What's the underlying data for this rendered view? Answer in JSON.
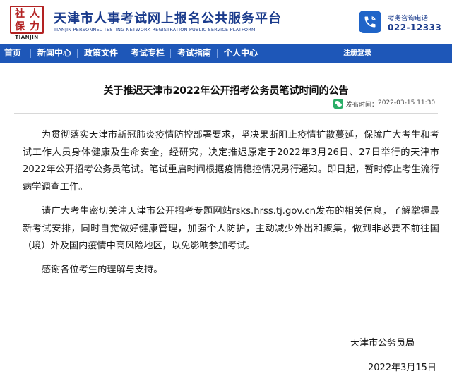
{
  "header": {
    "logo_text": "社人力保",
    "logo_chars": [
      "社",
      "人",
      "保",
      "力"
    ],
    "logo_english": "TIANJIN",
    "site_title": "天津市人事考试网上报名公共服务平台",
    "site_subtitle": "TIANJIN PERSONNEL TESTING NETWORK REGISTRATION PUBLIC SERVICE PLATFORM",
    "hotline_label": "考务咨询电话",
    "hotline_number": "022-12333",
    "phone_icon": "phone-icon",
    "brand_color": "#1a3b8c",
    "seal_color": "#b32222"
  },
  "nav": {
    "items": [
      {
        "label": "首页"
      },
      {
        "label": "新闻中心"
      },
      {
        "label": "政策文件"
      },
      {
        "label": "考试专栏"
      },
      {
        "label": "考试指南"
      },
      {
        "label": "个人中心"
      }
    ],
    "login_label": "注册登录",
    "bar_color": "#1e57b8"
  },
  "article": {
    "title": "关于推迟天津市2022年公开招考公务员笔试时间的公告",
    "publish_icon": "wechat-icon",
    "publish_label": "发布时间：",
    "publish_time": "2022-03-15 11:30",
    "paragraphs": [
      "为贯彻落实天津市新冠肺炎疫情防控部署要求，坚决果断阻止疫情扩散蔓延，保障广大考生和考试工作人员身体健康及生命安全，经研究，决定推迟原定于2022年3月26日、27日举行的天津市2022年公开招考公务员笔试。笔试重启时间根据疫情稳控情况另行通知。即日起，暂时停止考生流行病学调查工作。",
      "请广大考生密切关注天津市公开招考专题网站rsks.hrss.tj.gov.cn发布的相关信息，了解掌握最新考试安排，同时自觉做好健康管理，加强个人防护，主动减少外出和聚集，做到非必要不前往国（境）外及国内疫情中高风险地区，以免影响参加考试。",
      "感谢各位考生的理解与支持。"
    ],
    "signature_org": "天津市公务员局",
    "signature_date": "2022年3月15日"
  }
}
